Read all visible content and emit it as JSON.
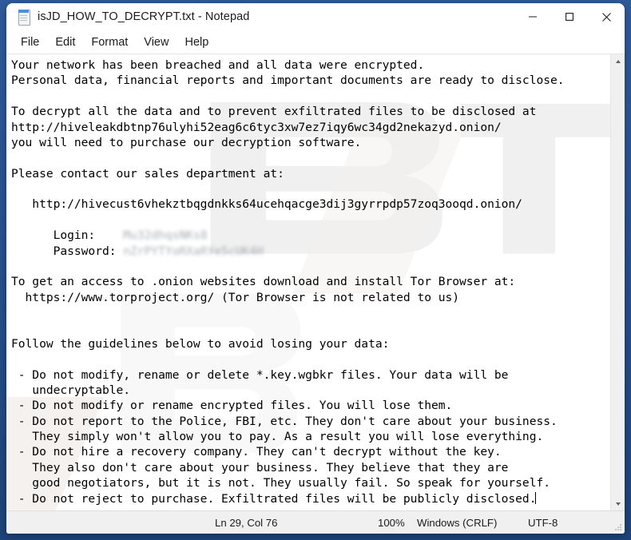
{
  "window": {
    "title": "isJD_HOW_TO_DECRYPT.txt - Notepad",
    "app_icon": "notepad-document-icon",
    "controls": {
      "minimize": "—",
      "maximize": "□",
      "close": "✕"
    }
  },
  "menu": {
    "items": [
      {
        "label": "File"
      },
      {
        "label": "Edit"
      },
      {
        "label": "Format"
      },
      {
        "label": "View"
      },
      {
        "label": "Help"
      }
    ]
  },
  "document": {
    "lines": [
      {
        "text": "Your network has been breached and all data were encrypted."
      },
      {
        "text": "Personal data, financial reports and important documents are ready to disclose."
      },
      {
        "text": ""
      },
      {
        "text": "To decrypt all the data and to prevent exfiltrated files to be disclosed at"
      },
      {
        "text": "http://hiveleakdbtnp76ulyhi52eag6c6tyc3xw7ez7iqy6wc34gd2nekazyd.onion/"
      },
      {
        "text": "you will need to purchase our decryption software."
      },
      {
        "text": ""
      },
      {
        "text": "Please contact our sales department at:"
      },
      {
        "text": ""
      },
      {
        "text": "   http://hivecust6vhekztbqgdnkks64ucehqacge3dij3gyrrpdp57zoq3ooqd.onion/"
      },
      {
        "text": ""
      },
      {
        "text": "      Login:    ",
        "redacted": "Mu32dhqsNKs8"
      },
      {
        "text": "      Password: ",
        "redacted": "nZrPYTYoRXaRYe5cUK4H"
      },
      {
        "text": ""
      },
      {
        "text": "To get an access to .onion websites download and install Tor Browser at:"
      },
      {
        "text": "  https://www.torproject.org/ (Tor Browser is not related to us)"
      },
      {
        "text": ""
      },
      {
        "text": ""
      },
      {
        "text": "Follow the guidelines below to avoid losing your data:"
      },
      {
        "text": ""
      },
      {
        "text": " - Do not modify, rename or delete *.key.wgbkr files. Your data will be"
      },
      {
        "text": "   undecryptable."
      },
      {
        "text": " - Do not modify or rename encrypted files. You will lose them."
      },
      {
        "text": " - Do not report to the Police, FBI, etc. They don't care about your business."
      },
      {
        "text": "   They simply won't allow you to pay. As a result you will lose everything."
      },
      {
        "text": " - Do not hire a recovery company. They can't decrypt without the key."
      },
      {
        "text": "   They also don't care about your business. They believe that they are"
      },
      {
        "text": "   good negotiators, but it is not. They usually fail. So speak for yourself."
      },
      {
        "text": " - Do not reject to purchase. Exfiltrated files will be publicly disclosed.",
        "caret": true
      }
    ]
  },
  "scrollbar": {
    "up_arrow": "scroll-up-arrow",
    "down_arrow": "scroll-down-arrow"
  },
  "status_bar": {
    "ln_col": "Ln 29, Col 76",
    "zoom": "100%",
    "line_ending": "Windows (CRLF)",
    "encoding": "UTF-8"
  },
  "colors": {
    "window_frame": "#2a5699",
    "title_bar": "#ffffff",
    "status_bar": "#f0f0f0",
    "text": "#000000",
    "close_hover": "#e81123"
  }
}
